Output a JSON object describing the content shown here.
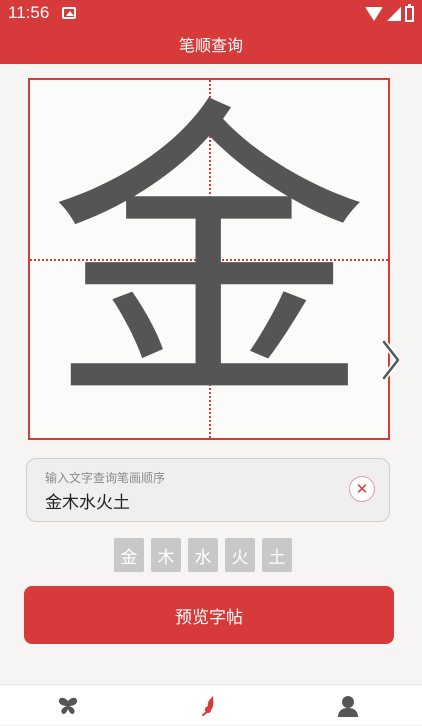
{
  "status_bar": {
    "time": "11:56"
  },
  "header": {
    "title": "笔顺查询"
  },
  "display": {
    "character": "金"
  },
  "input": {
    "hint": "输入文字查询笔画顺序",
    "value": "金木水火土"
  },
  "chips": [
    "金",
    "木",
    "水",
    "火",
    "土"
  ],
  "preview_button": {
    "label": "预览字帖"
  },
  "nav": {
    "items": [
      {
        "icon": "butterfly-icon"
      },
      {
        "icon": "brush-icon",
        "active": true
      },
      {
        "icon": "person-icon"
      }
    ]
  },
  "colors": {
    "accent": "#d63a3a",
    "chip": "#c8c8c8",
    "glyph": "#555555"
  }
}
